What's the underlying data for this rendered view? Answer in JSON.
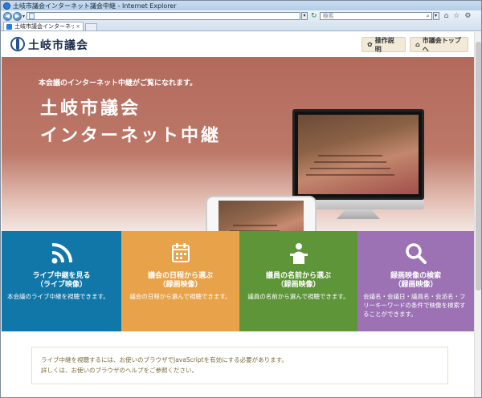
{
  "window": {
    "title": "土岐市議会インターネット議会中継 - Internet Explorer"
  },
  "browser": {
    "url": "",
    "search_placeholder": "検索",
    "tab_label": "土岐市議会インターネット議...",
    "icons": [
      "back-icon",
      "forward-icon",
      "refresh-icon",
      "search-icon",
      "home-icon",
      "favorites-icon",
      "tools-icon"
    ]
  },
  "site": {
    "title": "土岐市議会",
    "help_button": "操作説明",
    "top_button": "市議会トップへ"
  },
  "hero": {
    "lead": "本会議のインターネット中継がご覧になれます。",
    "title_line1": "土岐市議会",
    "title_line2": "インターネット中継"
  },
  "tiles": [
    {
      "title1": "ライブ中継を見る",
      "title2": "（ライブ映像）",
      "desc": "本会議のライブ中継を視聴できます。",
      "icon": "wifi-icon",
      "color": "#1177a9"
    },
    {
      "title1": "議会の日程から選ぶ",
      "title2": "（録画映像）",
      "desc": "議会の日程から選んで視聴できます。",
      "icon": "calendar-icon",
      "color": "#e8a24a"
    },
    {
      "title1": "議員の名前から選ぶ",
      "title2": "（録画映像）",
      "desc": "議員の名前から選んで視聴できます。",
      "icon": "speaker-podium-icon",
      "color": "#5e9538"
    },
    {
      "title1": "録画映像の検索",
      "title2": "（録画映像）",
      "desc": "会議名・会議日・議員名・会派名・フリーキーワードの条件で映像を検索することができます。",
      "icon": "search-icon",
      "color": "#9c72b4"
    }
  ],
  "notice": {
    "line1": "ライブ中継を視聴するには、お使いのブラウザでJavaScriptを有効にする必要があります。",
    "line2": "詳しくは、お使いのブラウザのヘルプをご参照ください。"
  }
}
